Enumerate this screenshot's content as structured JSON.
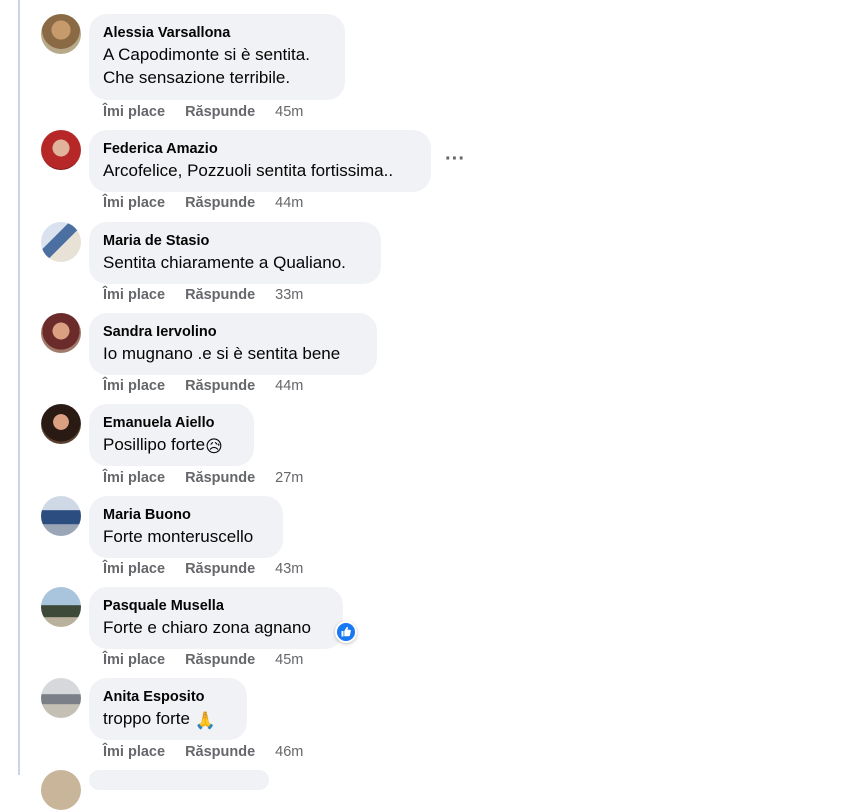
{
  "action_labels": {
    "like": "Îmi place",
    "reply": "Răspunde"
  },
  "comments": [
    {
      "author": "Alessia Varsallona",
      "lines": [
        "A Capodimonte si è sentita.",
        "Che sensazione terribile."
      ],
      "time": "45m"
    },
    {
      "author": "Federica Amazio",
      "lines": [
        "Arcofelice, Pozzuoli sentita fortissima.."
      ],
      "time": "44m"
    },
    {
      "author": "Maria de Stasio",
      "lines": [
        "Sentita chiaramente a Qualiano."
      ],
      "time": "33m"
    },
    {
      "author": "Sandra Iervolino",
      "lines": [
        "Io mugnano .e si è sentita bene"
      ],
      "time": "44m"
    },
    {
      "author": "Emanuela Aiello",
      "lines": [
        "Posillipo forte"
      ],
      "emoji": "😥",
      "time": "27m"
    },
    {
      "author": "Maria Buono",
      "lines": [
        "Forte monteruscello"
      ],
      "time": "43m"
    },
    {
      "author": "Pasquale Musella",
      "lines": [
        "Forte e chiaro zona agnano"
      ],
      "time": "45m",
      "reaction": "like-icon"
    },
    {
      "author": "Anita Esposito",
      "lines": [
        "troppo forte "
      ],
      "emoji": "🙏",
      "time": "46m"
    }
  ],
  "colors": {
    "bubble": "#f0f2f5",
    "secondary_text": "#65676b",
    "like_blue": "#1877f2"
  }
}
